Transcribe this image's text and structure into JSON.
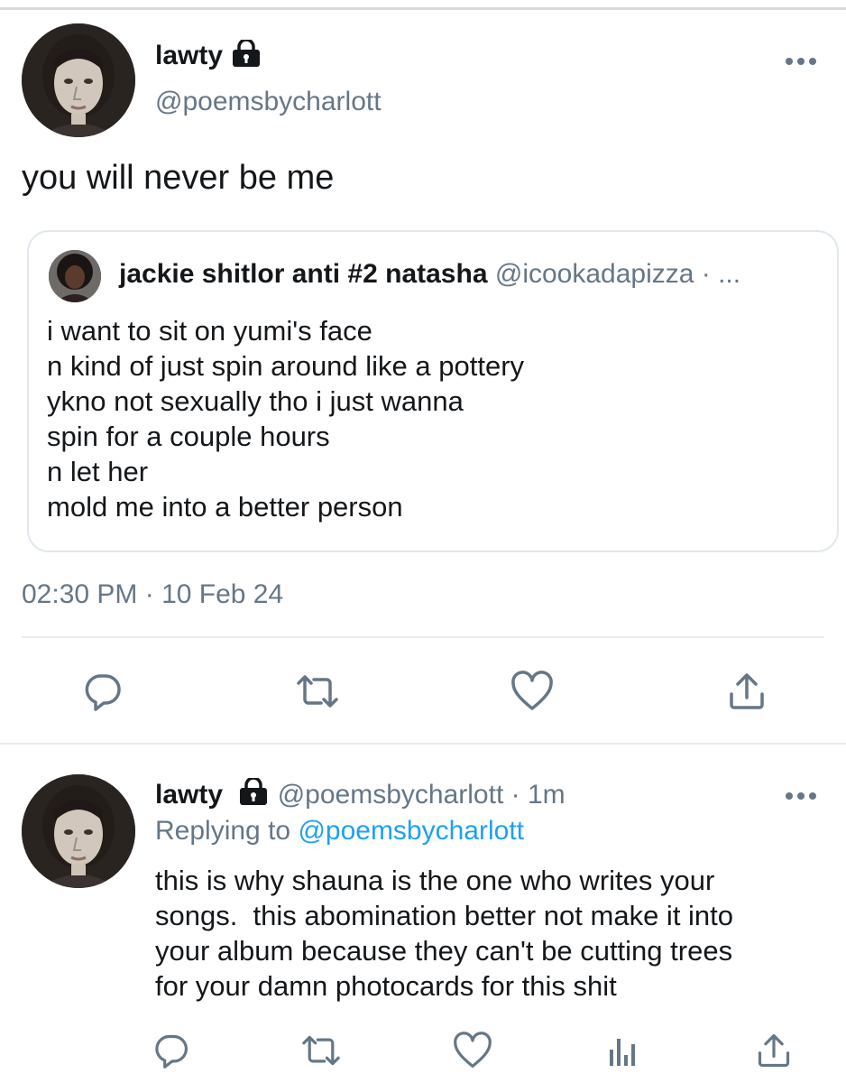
{
  "main_tweet": {
    "display_name": "lawty",
    "handle": "@poemsbycharlott",
    "text": "you will never be me",
    "timestamp": "02:30 PM · 10 Feb 24",
    "avatar_icon": "portrait-avatar",
    "lock_icon": "lock-icon",
    "more_icon": "more-options-icon"
  },
  "quoted_tweet": {
    "display_name": "jackie shitlor anti #2 natasha",
    "handle_and_time": "@icookadapizza · ...",
    "lines": [
      "i want to sit on yumi's face",
      "n kind of just spin around like a pottery",
      "ykno not sexually tho i just wanna",
      "spin for a couple hours",
      "n let her",
      "mold me into a better person"
    ]
  },
  "main_actions": [
    "reply-icon",
    "retweet-icon",
    "like-icon",
    "share-icon"
  ],
  "reply_tweet": {
    "display_name": "lawty",
    "handle_time": "@poemsbycharlott · 1m",
    "replying_prefix": "Replying to ",
    "replying_mention": "@poemsbycharlott",
    "lines": [
      "this is why shauna is the one who writes your",
      "songs.  this abomination better not make it into",
      "your album because they can't be cutting trees",
      "for your damn photocards for this shit"
    ]
  },
  "reply_actions": [
    "reply-icon",
    "retweet-icon",
    "like-icon",
    "analytics-icon",
    "share-icon"
  ],
  "colors": {
    "text": "#14171a",
    "secondary": "#657786",
    "link": "#1da1f2",
    "border": "#e1e8ed"
  }
}
